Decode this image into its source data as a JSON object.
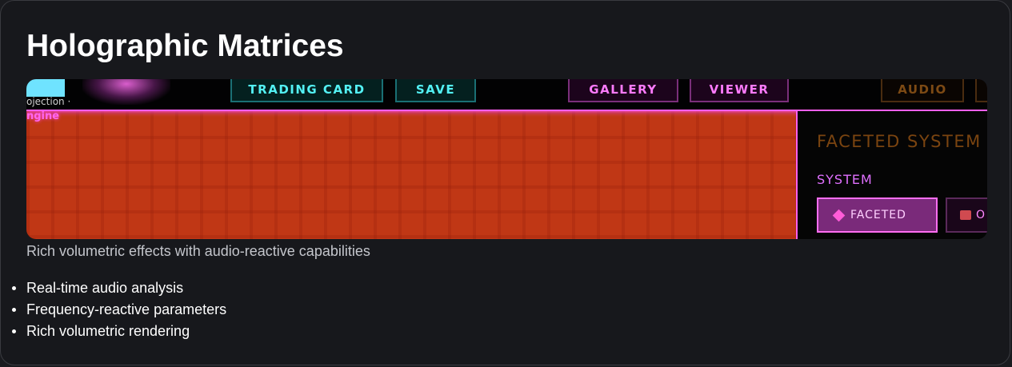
{
  "card": {
    "title": "Holographic Matrices",
    "caption": "Rich volumetric effects with audio-reactive capabilities",
    "features": [
      "Real-time audio analysis",
      "Frequency-reactive parameters",
      "Rich volumetric rendering"
    ]
  },
  "preview": {
    "logo_sub": "ojection ·",
    "engine_label": "ngine",
    "toolbar": {
      "trading_card": "TRADING CARD",
      "save": "SAVE",
      "gallery": "GALLERY",
      "viewer": "VIEWER",
      "audio": "AUDIO"
    },
    "panel": {
      "title": "FACETED SYSTEM",
      "subtitle": "SYSTEM",
      "faceted_button": "FACETED",
      "other_button": "O"
    }
  },
  "colors": {
    "accent_magenta": "#ff5ff0",
    "canvas_red": "#c03715",
    "teal": "#53f1f4"
  }
}
